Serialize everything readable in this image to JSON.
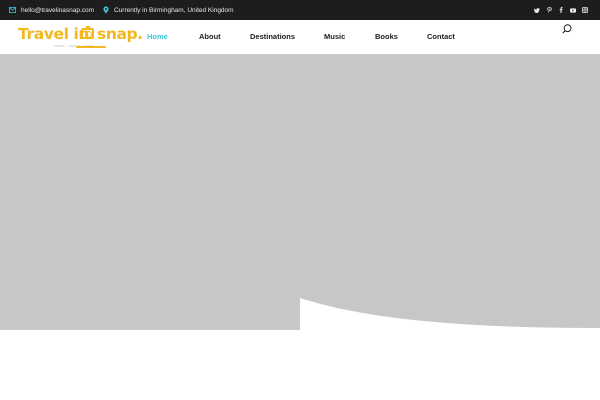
{
  "topbar": {
    "email": "hello@travelinasnap.com",
    "location": "Currently in Birmingham, United Kingdom",
    "social_icons": [
      "twitter-icon",
      "pinterest-icon",
      "facebook-icon",
      "youtube-icon",
      "instagram-icon"
    ]
  },
  "logo": {
    "part1": "Travel in",
    "part2": "snap.",
    "icon": "camera-icon",
    "tagline": "wander · capture · inspire"
  },
  "nav": {
    "items": [
      {
        "label": "Home",
        "active": true
      },
      {
        "label": "About",
        "active": false
      },
      {
        "label": "Destinations",
        "active": false
      },
      {
        "label": "Music",
        "active": false
      },
      {
        "label": "Books",
        "active": false
      },
      {
        "label": "Contact",
        "active": false
      }
    ],
    "search_icon": "search-icon"
  },
  "colors": {
    "topbar_bg": "#1d1d1d",
    "accent": "#3ec3d5",
    "brand_yellow": "#f3b820",
    "hero_bg": "#c6c7c9"
  }
}
